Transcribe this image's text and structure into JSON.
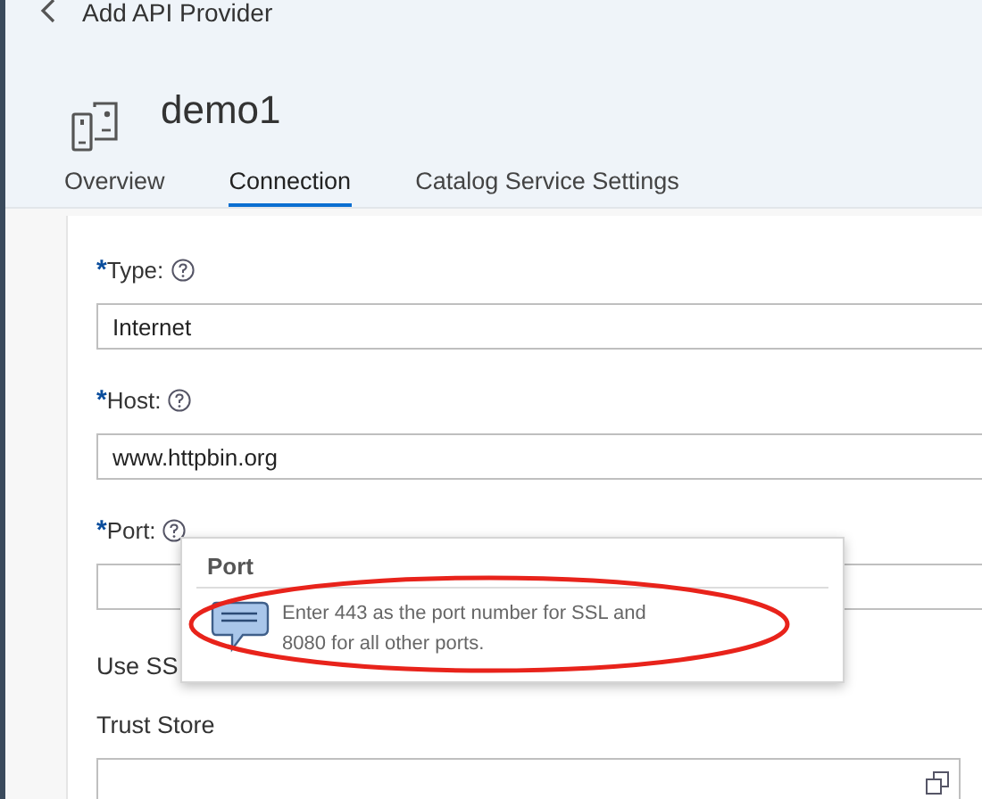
{
  "header": {
    "title": "Add API Provider",
    "object_title": "demo1"
  },
  "tabs": [
    {
      "label": "Overview",
      "selected": false
    },
    {
      "label": "Connection",
      "selected": true
    },
    {
      "label": "Catalog Service Settings",
      "selected": false
    }
  ],
  "fields": [
    {
      "label": "Type:",
      "required": true,
      "help": true,
      "value": "Internet"
    },
    {
      "label": "Host:",
      "required": true,
      "help": true,
      "value": "www.httpbin.org"
    },
    {
      "label": "Port:",
      "required": true,
      "help": true
    }
  ],
  "ssl_label": "Use SS",
  "trust_store": {
    "label": "Trust Store"
  },
  "popover": {
    "title": "Port",
    "text": "Enter 443 as the port number for SSL and 8080 for all other ports."
  },
  "required_mark": "*"
}
